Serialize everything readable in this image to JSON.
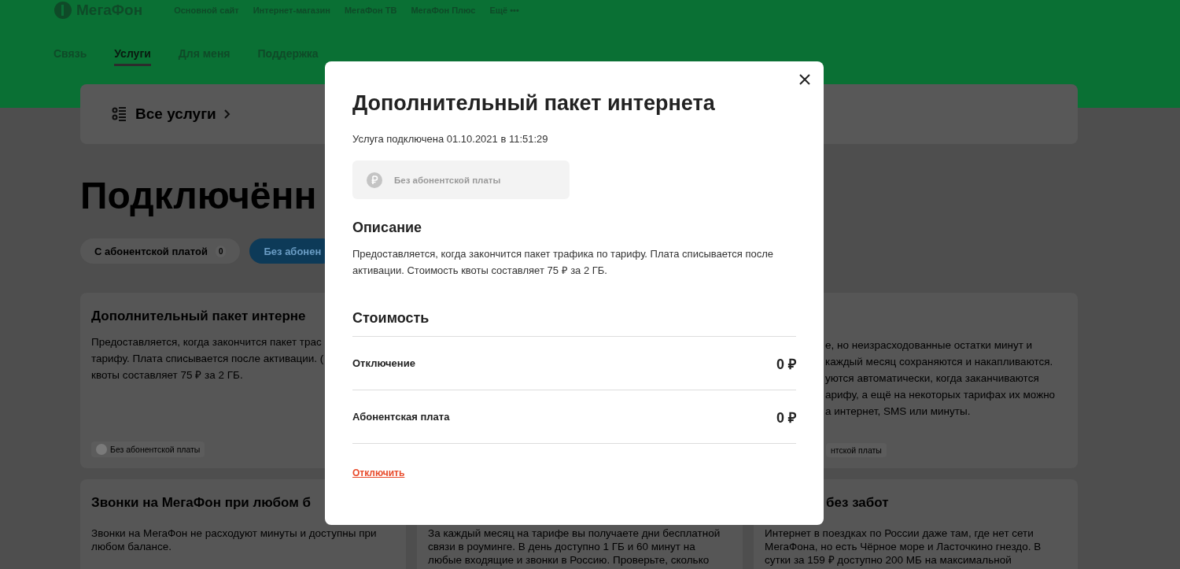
{
  "header": {
    "logo": "МегаФон",
    "links": [
      "Основной сайт",
      "Интернет-магазин",
      "МегаФон ТВ",
      "МегаФон Плюс",
      "Ещё •••"
    ],
    "tabs": [
      {
        "label": "Связь",
        "selected": false
      },
      {
        "label": "Услуги",
        "selected": true
      },
      {
        "label": "Для меня",
        "selected": false
      },
      {
        "label": "Поддержка",
        "selected": false
      }
    ]
  },
  "all_services": {
    "label": "Все услуги"
  },
  "page_title": "Подключённ",
  "filters": [
    {
      "label": "С абонентской платой",
      "count": "0",
      "selected": false
    },
    {
      "label": "Без абонен",
      "selected": true
    }
  ],
  "cards": [
    {
      "title": "Дополнительный пакет интерне",
      "lines": [
        "Предоставляется, когда закончится пакет трас",
        "тарифу. Плата списывается после активации. (",
        "квоты составляет 75 ₽ за 2 ГБ."
      ],
      "tag": "Без абонентской платы"
    },
    {
      "lines": [
        "е, но неизрасходованные остатки минут и",
        "каждый месяц сохраняются и накапливаются.",
        "уются автоматически, когда заканчиваются",
        "арифу, а ещё на некоторых тарифах их можно",
        "а интернет, SMS или минуты."
      ],
      "tag": "нтской платы"
    },
    {
      "title": "Звонки на МегаФон при любом б",
      "lines": [
        "Звонки на МегаФон не расходуют минуты и доступны при",
        "любом балансе."
      ]
    },
    {
      "lines": [
        "За каждый месяц на тарифе вы получаете дни бесплатной",
        "связи в роуминге. В день доступно 1 ГБ и 60 минут на",
        "любые входящие и звонки в Россию. Проверьте, сколько"
      ]
    },
    {
      "title": "без забот",
      "lines": [
        "Интернет в поездках по России даже там, где нет сети",
        "МегаФона, но есть Чёрное море и Ласточкино гнездо. В",
        "сутки за 159 ₽ доступно 200 МБ на максимальной"
      ]
    }
  ],
  "modal": {
    "title": "Дополнительный пакет интернета",
    "subtitle": "Услуга подключена 01.10.2021 в 11:51:29",
    "tag": "Без абонентской платы",
    "description_heading": "Описание",
    "description": "Предоставляется, когда закончится пакет трафика по тарифу. Плата списывается после активации. Стоимость квоты составляет 75 ₽ за 2 ГБ.",
    "cost_heading": "Стоимость",
    "costs": [
      {
        "label": "Отключение",
        "value": "0 ₽"
      },
      {
        "label": "Абонентская плата",
        "value": "0 ₽"
      }
    ],
    "action": "Отключить"
  }
}
